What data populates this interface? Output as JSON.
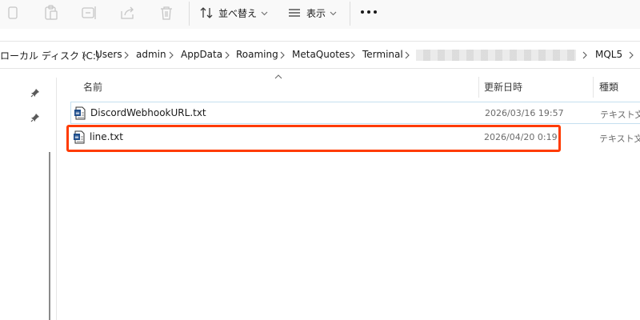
{
  "toolbar": {
    "sort_label": "並べ替え",
    "view_label": "表示",
    "icons": [
      "copy-icon",
      "paste-icon",
      "rename-icon",
      "share-icon",
      "delete-icon",
      "sort-icon",
      "view-icon",
      "more-icon"
    ]
  },
  "breadcrumb": {
    "items": [
      "ローカル ディスク (C:)",
      "Users",
      "admin",
      "AppData",
      "Roaming",
      "MetaQuotes",
      "Terminal",
      "MQL5"
    ]
  },
  "columns": {
    "name": "名前",
    "modified": "更新日時",
    "type": "種類"
  },
  "files": [
    {
      "name": "DiscordWebhookURL.txt",
      "modified": "2026/03/16 19:57",
      "type": "テキスト文書"
    },
    {
      "name": "line.txt",
      "modified": "2026/04/20 0:19",
      "type": "テキスト文書"
    }
  ],
  "colors": {
    "highlight": "#ff3b00",
    "selection_border": "#c4dff0"
  }
}
